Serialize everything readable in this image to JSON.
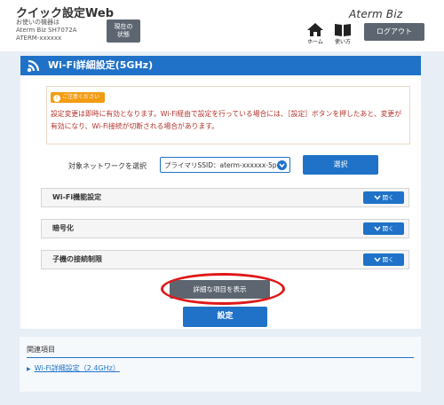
{
  "header": {
    "app_title": "クイック設定Web",
    "device_lines": [
      "お使いの機器は",
      "Aterm Biz SH7072A",
      "ATERM-xxxxxx"
    ],
    "status_button": [
      "現在の",
      "状態"
    ],
    "home_label": "ホーム",
    "guide_label": "使い方",
    "brand": "Aterm Biz",
    "logout_label": "ログアウト"
  },
  "panel": {
    "title": "Wi-Fi詳細設定(5GHz)",
    "notice_badge": "ご注意ください",
    "notice_text": "設定変更は即時に有効となります。Wi-Fi経由で設定を行っている場合には、［設定］ボタンを押したあと、変更が有効になり、Wi-Fi接続が切断される場合があります。",
    "network_label": "対象ネットワークを選択",
    "network_selected": "プライマリSSID：aterm-xxxxxx-5p",
    "select_button": "選択",
    "sections": [
      {
        "label": "Wi-Fi機能設定",
        "button": "開く"
      },
      {
        "label": "暗号化",
        "button": "開く"
      },
      {
        "label": "子機の接続制限",
        "button": "開く"
      }
    ],
    "show_detail_button": "詳細な項目を表示",
    "submit_button": "設定"
  },
  "related": {
    "title": "関連項目",
    "link": "Wi-Fi詳細設定（2.4GHz）"
  },
  "colors": {
    "accent": "#2072c8",
    "dark_button": "#5d6670",
    "warning": "#b0322a",
    "highlight_ring": "#e01818"
  }
}
